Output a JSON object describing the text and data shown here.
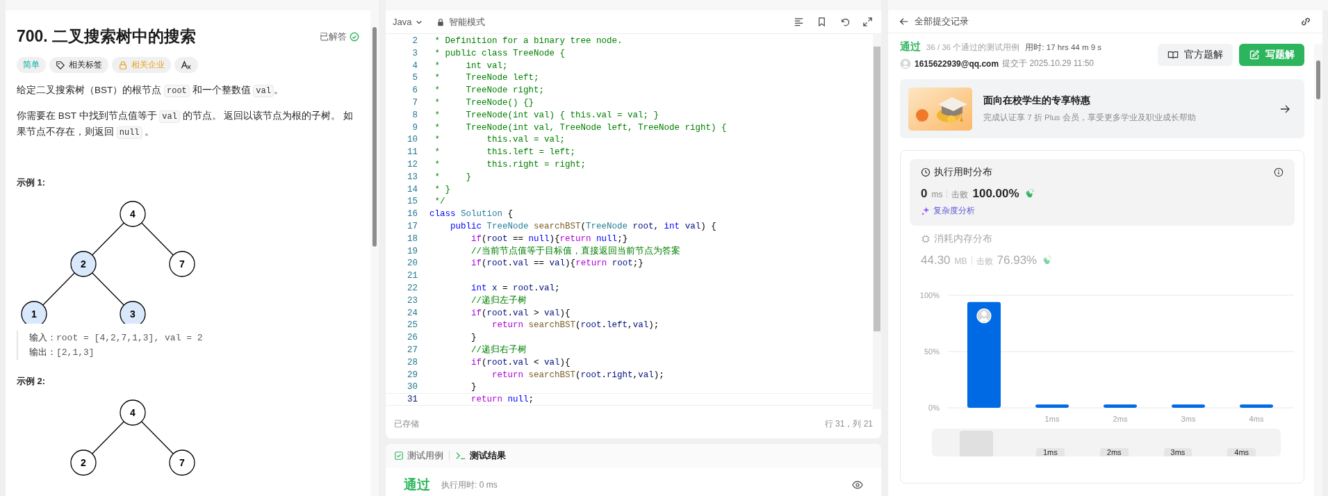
{
  "problem": {
    "title": "700. 二叉搜索树中的搜索",
    "status": {
      "label": "已解答",
      "solved": true
    },
    "tags": [
      {
        "kind": "difficulty",
        "label": "简单"
      },
      {
        "kind": "tag",
        "label": "相关标签"
      },
      {
        "kind": "locked",
        "label": "相关企业"
      },
      {
        "kind": "translate"
      }
    ],
    "paragraphs": [
      [
        {
          "t": "给定二叉搜索树（BST）的根节点 "
        },
        {
          "code": "root"
        },
        {
          "t": " 和一个整数值 "
        },
        {
          "code": "val"
        },
        {
          "t": "。"
        }
      ],
      [
        {
          "t": "你需要在 BST 中找到节点值等于 "
        },
        {
          "code": "val"
        },
        {
          "t": " 的节点。 返回以该节点为根的子树。 如果节点不存在，则返回 "
        },
        {
          "code": "null"
        },
        {
          "t": " 。"
        }
      ]
    ],
    "examples": [
      {
        "title": "示例 1:",
        "tree": {
          "value": "4",
          "highlighted": false,
          "children": [
            {
              "kind": "left",
              "value": "2",
              "highlighted": true,
              "children": [
                {
                  "kind": "left",
                  "value": "1",
                  "highlighted": true
                },
                {
                  "kind": "right",
                  "value": "3",
                  "highlighted": true
                }
              ]
            },
            {
              "kind": "right",
              "value": "7",
              "highlighted": false
            }
          ]
        },
        "io": [
          {
            "label": "输入：",
            "value": "root = [4,2,7,1,3], val = 2"
          },
          {
            "label": "输出：",
            "value": "[2,1,3]"
          }
        ]
      },
      {
        "title": "示例 2:",
        "tree": {
          "value": "4",
          "highlighted": false,
          "children": [
            {
              "kind": "left",
              "value": "2",
              "highlighted": false
            },
            {
              "kind": "right",
              "value": "7",
              "highlighted": false
            }
          ]
        }
      }
    ]
  },
  "editor": {
    "language": "Java",
    "mode": "智能模式",
    "status": "已存储",
    "cursor": "行 31，列 21",
    "lines": [
      {
        "n": "2",
        "active": false,
        "tokens": [
          {
            "kind": "cm",
            "t": " * Definition for a binary tree node."
          }
        ]
      },
      {
        "n": "3",
        "active": false,
        "tokens": [
          {
            "kind": "cm",
            "t": " * public class TreeNode {"
          }
        ]
      },
      {
        "n": "4",
        "active": false,
        "tokens": [
          {
            "kind": "cm",
            "t": " *     int val;"
          }
        ]
      },
      {
        "n": "5",
        "active": false,
        "tokens": [
          {
            "kind": "cm",
            "t": " *     TreeNode left;"
          }
        ]
      },
      {
        "n": "6",
        "active": false,
        "tokens": [
          {
            "kind": "cm",
            "t": " *     TreeNode right;"
          }
        ]
      },
      {
        "n": "7",
        "active": false,
        "tokens": [
          {
            "kind": "cm",
            "t": " *     TreeNode() {}"
          }
        ]
      },
      {
        "n": "8",
        "active": false,
        "tokens": [
          {
            "kind": "cm",
            "t": " *     TreeNode(int val) { this.val = val; }"
          }
        ]
      },
      {
        "n": "9",
        "active": false,
        "tokens": [
          {
            "kind": "cm",
            "t": " *     TreeNode(int val, TreeNode left, TreeNode right) {"
          }
        ]
      },
      {
        "n": "10",
        "active": false,
        "tokens": [
          {
            "kind": "cm",
            "t": " *         this.val = val;"
          }
        ]
      },
      {
        "n": "11",
        "active": false,
        "tokens": [
          {
            "kind": "cm",
            "t": " *         this.left = left;"
          }
        ]
      },
      {
        "n": "12",
        "active": false,
        "tokens": [
          {
            "kind": "cm",
            "t": " *         this.right = right;"
          }
        ]
      },
      {
        "n": "13",
        "active": false,
        "tokens": [
          {
            "kind": "cm",
            "t": " *     }"
          }
        ]
      },
      {
        "n": "14",
        "active": false,
        "tokens": [
          {
            "kind": "cm",
            "t": " * }"
          }
        ]
      },
      {
        "n": "15",
        "active": false,
        "tokens": [
          {
            "kind": "cm",
            "t": " */"
          }
        ]
      },
      {
        "n": "16",
        "active": false,
        "tokens": [
          {
            "kind": "kw",
            "t": "class"
          },
          {
            "kind": "type",
            "t": " Solution"
          },
          {
            "kind": "pl",
            "t": " {"
          }
        ]
      },
      {
        "n": "17",
        "active": false,
        "tokens": [
          {
            "kind": "kw",
            "t": "    public"
          },
          {
            "kind": "type",
            "t": " TreeNode"
          },
          {
            "kind": "fn",
            "t": " searchBST"
          },
          {
            "kind": "pl",
            "t": "("
          },
          {
            "kind": "type",
            "t": "TreeNode"
          },
          {
            "kind": "var",
            "t": " root"
          },
          {
            "kind": "pl",
            "t": ", "
          },
          {
            "kind": "kw",
            "t": "int"
          },
          {
            "kind": "var",
            "t": " val"
          },
          {
            "kind": "pl",
            "t": ") {"
          }
        ]
      },
      {
        "n": "18",
        "active": false,
        "tokens": [
          {
            "kind": "ctl",
            "t": "        if"
          },
          {
            "kind": "pl",
            "t": "("
          },
          {
            "kind": "var",
            "t": "root"
          },
          {
            "kind": "pl",
            "t": " == "
          },
          {
            "kind": "kw",
            "t": "null"
          },
          {
            "kind": "pl",
            "t": "){"
          },
          {
            "kind": "ctl",
            "t": "return"
          },
          {
            "kind": "kw",
            "t": " null"
          },
          {
            "kind": "pl",
            "t": ";}"
          }
        ]
      },
      {
        "n": "19",
        "active": false,
        "tokens": [
          {
            "kind": "cm",
            "t": "        //当前节点值等于目标值，直接返回当前节点为答案"
          }
        ]
      },
      {
        "n": "20",
        "active": false,
        "tokens": [
          {
            "kind": "ctl",
            "t": "        if"
          },
          {
            "kind": "pl",
            "t": "("
          },
          {
            "kind": "var",
            "t": "root"
          },
          {
            "kind": "pl",
            "t": "."
          },
          {
            "kind": "var",
            "t": "val"
          },
          {
            "kind": "pl",
            "t": " == "
          },
          {
            "kind": "var",
            "t": "val"
          },
          {
            "kind": "pl",
            "t": "){"
          },
          {
            "kind": "ctl",
            "t": "return"
          },
          {
            "kind": "var",
            "t": " root"
          },
          {
            "kind": "pl",
            "t": ";}"
          }
        ]
      },
      {
        "n": "21",
        "active": false
      },
      {
        "n": "22",
        "active": false,
        "tokens": [
          {
            "kind": "kw",
            "t": "        int"
          },
          {
            "kind": "var",
            "t": " x"
          },
          {
            "kind": "pl",
            "t": " = "
          },
          {
            "kind": "var",
            "t": "root"
          },
          {
            "kind": "pl",
            "t": "."
          },
          {
            "kind": "var",
            "t": "val"
          },
          {
            "kind": "pl",
            "t": ";"
          }
        ]
      },
      {
        "n": "23",
        "active": false,
        "tokens": [
          {
            "kind": "cm",
            "t": "        //递归左子树"
          }
        ]
      },
      {
        "n": "24",
        "active": false,
        "tokens": [
          {
            "kind": "ctl",
            "t": "        if"
          },
          {
            "kind": "pl",
            "t": "("
          },
          {
            "kind": "var",
            "t": "root"
          },
          {
            "kind": "pl",
            "t": "."
          },
          {
            "kind": "var",
            "t": "val"
          },
          {
            "kind": "pl",
            "t": " > "
          },
          {
            "kind": "var",
            "t": "val"
          },
          {
            "kind": "pl",
            "t": "){"
          }
        ]
      },
      {
        "n": "25",
        "active": false,
        "tokens": [
          {
            "kind": "ctl",
            "t": "            return"
          },
          {
            "kind": "fn",
            "t": " searchBST"
          },
          {
            "kind": "pl",
            "t": "("
          },
          {
            "kind": "var",
            "t": "root"
          },
          {
            "kind": "pl",
            "t": "."
          },
          {
            "kind": "var",
            "t": "left"
          },
          {
            "kind": "pl",
            "t": ","
          },
          {
            "kind": "var",
            "t": "val"
          },
          {
            "kind": "pl",
            "t": ");"
          }
        ]
      },
      {
        "n": "26",
        "active": false,
        "tokens": [
          {
            "kind": "pl",
            "t": "        }"
          }
        ]
      },
      {
        "n": "27",
        "active": false,
        "tokens": [
          {
            "kind": "cm",
            "t": "        //递归右子树"
          }
        ]
      },
      {
        "n": "28",
        "active": false,
        "tokens": [
          {
            "kind": "ctl",
            "t": "        if"
          },
          {
            "kind": "pl",
            "t": "("
          },
          {
            "kind": "var",
            "t": "root"
          },
          {
            "kind": "pl",
            "t": "."
          },
          {
            "kind": "var",
            "t": "val"
          },
          {
            "kind": "pl",
            "t": " < "
          },
          {
            "kind": "var",
            "t": "val"
          },
          {
            "kind": "pl",
            "t": "){"
          }
        ]
      },
      {
        "n": "29",
        "active": false,
        "tokens": [
          {
            "kind": "ctl",
            "t": "            return"
          },
          {
            "kind": "fn",
            "t": " searchBST"
          },
          {
            "kind": "pl",
            "t": "("
          },
          {
            "kind": "var",
            "t": "root"
          },
          {
            "kind": "pl",
            "t": "."
          },
          {
            "kind": "var",
            "t": "right"
          },
          {
            "kind": "pl",
            "t": ","
          },
          {
            "kind": "var",
            "t": "val"
          },
          {
            "kind": "pl",
            "t": ");"
          }
        ]
      },
      {
        "n": "30",
        "active": false,
        "tokens": [
          {
            "kind": "pl",
            "t": "        }"
          }
        ]
      },
      {
        "n": "31",
        "active": true,
        "tokens": [
          {
            "kind": "ctl",
            "t": "        return"
          },
          {
            "kind": "kw",
            "t": " null"
          },
          {
            "kind": "pl",
            "t": ";"
          }
        ]
      }
    ]
  },
  "test_panel": {
    "tabs": [
      {
        "kind": "cases",
        "label": "测试用例",
        "selected": false
      },
      {
        "kind": "result",
        "label": "测试结果",
        "selected": true
      }
    ],
    "result": "通过",
    "runtime": "执行用时: 0 ms"
  },
  "submission": {
    "back_label": "全部提交记录",
    "status": "通过",
    "passed": "36 / 36 个通过的测试用例",
    "time": "用时: 17 hrs 44 m 9 s",
    "user": "1615622939@qq.com",
    "submitted": "提交于 2025.10.29 11:50",
    "buttons": [
      {
        "kind": "secondary",
        "label": "官方题解"
      },
      {
        "kind": "primary",
        "label": "写题解"
      }
    ],
    "promo": {
      "kind": "picture",
      "title": "面向在校学生的专享特惠",
      "subtitle": "完成认证享 7 折 Plus 会员，享受更多学业及职业成长帮助"
    },
    "metrics": [
      {
        "kind": "runtime",
        "selected": true,
        "title": "执行用时分布",
        "value": "0",
        "unit": "ms",
        "beats_label": "击败",
        "beats": "100.00%",
        "link": "复杂度分析"
      },
      {
        "kind": "memory",
        "selected": false,
        "title": "消耗内存分布",
        "value": "44.30",
        "unit": "MB",
        "beats_label": "击败",
        "beats": "76.93%"
      }
    ],
    "chart_data": {
      "type": "bar",
      "categories": [
        null,
        "1ms",
        "2ms",
        "3ms",
        "4ms"
      ],
      "series": [
        {
          "color": "#0069e4",
          "values": [
            94,
            3,
            3,
            3,
            3
          ]
        }
      ],
      "ylim": [
        0,
        100
      ],
      "yticks": [
        {
          "value": 0,
          "label": "0%"
        },
        {
          "value": 50,
          "label": "50%"
        },
        {
          "value": 100,
          "label": "100%"
        }
      ]
    },
    "navigator": {
      "labels": [
        "1ms",
        "2ms",
        "3ms",
        "4ms"
      ]
    }
  }
}
